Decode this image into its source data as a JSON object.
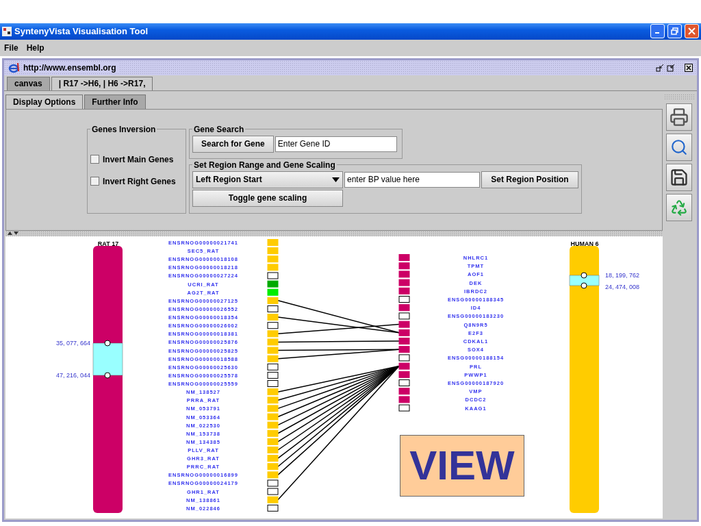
{
  "window": {
    "title": "SyntenyVista Visualisation Tool"
  },
  "menu": [
    "File",
    "Help"
  ],
  "frame": {
    "url": "http://www.ensembl.org"
  },
  "view_tabs": [
    {
      "label": "canvas",
      "selected": false
    },
    {
      "label": "| R17 ->H6, | H6 ->R17,",
      "selected": true
    }
  ],
  "option_tabs": [
    {
      "label": "Display Options",
      "selected": true
    },
    {
      "label": "Further Info",
      "selected": false
    }
  ],
  "genes_inversion": {
    "title": "Genes Inversion",
    "options": [
      {
        "label": "Invert Main Genes",
        "checked": false
      },
      {
        "label": "Invert Right Genes",
        "checked": false
      }
    ]
  },
  "gene_search": {
    "title": "Gene Search",
    "button": "Search for Gene",
    "value": "Enter Gene ID"
  },
  "region": {
    "title": "Set Region Range and Gene Scaling",
    "dropdown": "Left Region Start",
    "value": "enter BP value here",
    "button": "Set Region Position",
    "toggle": "Toggle gene scaling"
  },
  "canvas": {
    "chromosomes": [
      {
        "name": "RAT 17",
        "color": "#cc0066",
        "region_start": "35, 077, 664",
        "region_end": "47, 216, 044"
      },
      {
        "name": "HUMAN 6",
        "color": "#ffcc00",
        "region_start": "18, 199, 762",
        "region_end": "24, 474, 008"
      }
    ],
    "left_genes": [
      {
        "name": "ENSRNOG00000021741",
        "filled": true,
        "color": "#ffcc00"
      },
      {
        "name": "SEC5_RAT",
        "filled": true,
        "color": "#ffcc00"
      },
      {
        "name": "ENSRNOG00000018108",
        "filled": true,
        "color": "#ffcc00"
      },
      {
        "name": "ENSRNOG00000018218",
        "filled": true,
        "color": "#ffcc00"
      },
      {
        "name": "ENSRNOG00000027224",
        "filled": false
      },
      {
        "name": "UCRI_RAT",
        "filled": true,
        "color": "#00aa00"
      },
      {
        "name": "AG2T_RAT",
        "filled": true,
        "color": "#00ee00"
      },
      {
        "name": "ENSRNOG00000027125",
        "filled": true,
        "color": "#ffcc00",
        "linked": true
      },
      {
        "name": "ENSRNOG00000026552",
        "filled": false
      },
      {
        "name": "ENSRNOG00000018354",
        "filled": true,
        "color": "#ffcc00",
        "linked": true
      },
      {
        "name": "ENSRNOG00000026002",
        "filled": false
      },
      {
        "name": "ENSRNOG00000018381",
        "filled": true,
        "color": "#ffcc00",
        "linked": true
      },
      {
        "name": "ENSRNOG00000025876",
        "filled": true,
        "color": "#ffcc00",
        "linked": true
      },
      {
        "name": "ENSRNOG00000025825",
        "filled": true,
        "color": "#ffcc00",
        "linked": true
      },
      {
        "name": "ENSRNOG00000018588",
        "filled": true,
        "color": "#ffcc00",
        "linked": true
      },
      {
        "name": "ENSRNOG00000025630",
        "filled": false
      },
      {
        "name": "ENSRNOG00000025578",
        "filled": false
      },
      {
        "name": "ENSRNOG00000025559",
        "filled": false
      },
      {
        "name": "NM_138527",
        "filled": true,
        "color": "#ffcc00",
        "linked": true
      },
      {
        "name": "PRRA_RAT",
        "filled": true,
        "color": "#ffcc00",
        "linked": true
      },
      {
        "name": "NM_053791",
        "filled": true,
        "color": "#ffcc00",
        "linked": true
      },
      {
        "name": "NM_053364",
        "filled": true,
        "color": "#ffcc00",
        "linked": true
      },
      {
        "name": "NM_022530",
        "filled": true,
        "color": "#ffcc00",
        "linked": true
      },
      {
        "name": "NM_153738",
        "filled": true,
        "color": "#ffcc00",
        "linked": true
      },
      {
        "name": "NM_134385",
        "filled": true,
        "color": "#ffcc00",
        "linked": true
      },
      {
        "name": "PLLV_RAT",
        "filled": true,
        "color": "#ffcc00",
        "linked": true
      },
      {
        "name": "GHR3_RAT",
        "filled": true,
        "color": "#ffcc00",
        "linked": true
      },
      {
        "name": "PRRC_RAT",
        "filled": true,
        "color": "#ffcc00",
        "linked": true
      },
      {
        "name": "ENSRNOG00000016899",
        "filled": true,
        "color": "#ffcc00",
        "linked": true
      },
      {
        "name": "ENSRNOG00000024179",
        "filled": false
      },
      {
        "name": "GHR1_RAT",
        "filled": false
      },
      {
        "name": "NM_138861",
        "filled": true,
        "color": "#ffcc00",
        "linked": true
      },
      {
        "name": "NM_022846",
        "filled": false
      }
    ],
    "right_genes": [
      {
        "name": "NHLRC1",
        "filled": true,
        "color": "#cc0066"
      },
      {
        "name": "TPMT",
        "filled": true,
        "color": "#cc0066"
      },
      {
        "name": "AOF1",
        "filled": true,
        "color": "#cc0066"
      },
      {
        "name": "DEK",
        "filled": true,
        "color": "#cc0066"
      },
      {
        "name": "IBRDC2",
        "filled": true,
        "color": "#cc0066"
      },
      {
        "name": "ENSG00000188345",
        "filled": false
      },
      {
        "name": "ID4",
        "filled": true,
        "color": "#cc0066"
      },
      {
        "name": "ENSG00000183230",
        "filled": false
      },
      {
        "name": "Q8N9R5",
        "filled": true,
        "color": "#cc0066"
      },
      {
        "name": "E2F3",
        "filled": true,
        "color": "#cc0066"
      },
      {
        "name": "CDKAL1",
        "filled": true,
        "color": "#cc0066"
      },
      {
        "name": "SOX4",
        "filled": true,
        "color": "#cc0066"
      },
      {
        "name": "ENSG00000188154",
        "filled": false
      },
      {
        "name": "PRL",
        "filled": true,
        "color": "#cc0066"
      },
      {
        "name": "PWWP1",
        "filled": true,
        "color": "#cc0066"
      },
      {
        "name": "ENSG00000187920",
        "filled": false
      },
      {
        "name": "VMP",
        "filled": true,
        "color": "#cc0066"
      },
      {
        "name": "DCDC2",
        "filled": true,
        "color": "#cc0066"
      },
      {
        "name": "KAAG1",
        "filled": false
      }
    ],
    "stamp": "VIEW"
  }
}
